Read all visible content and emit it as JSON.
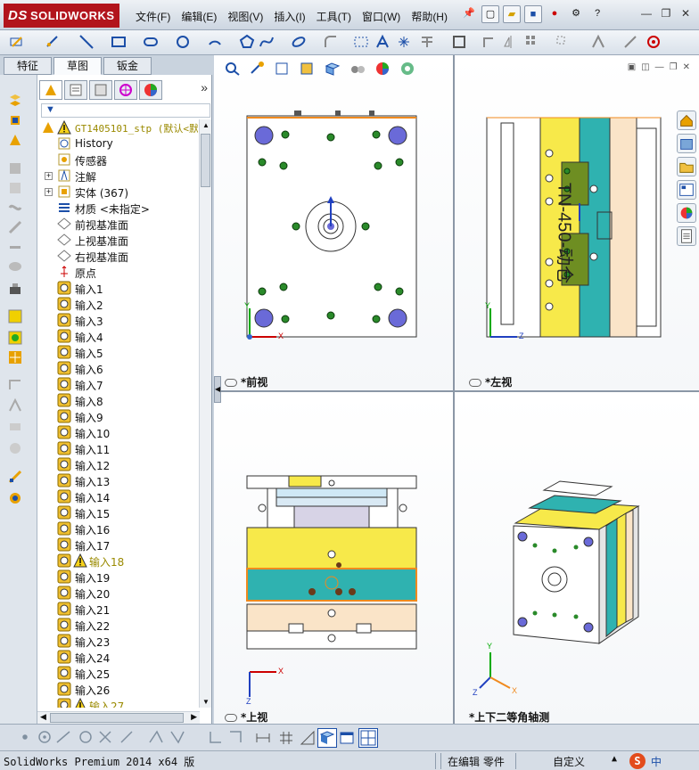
{
  "app": {
    "logo_text": "SOLIDWORKS",
    "logo_prefix": "DS"
  },
  "menu": [
    "文件(F)",
    "编辑(E)",
    "视图(V)",
    "插入(I)",
    "工具(T)",
    "窗口(W)",
    "帮助(H)"
  ],
  "quick_access": [
    "pin-icon",
    "new-icon",
    "open-icon",
    "save-icon",
    "rebuild-icon",
    "options-icon",
    "help-icon"
  ],
  "cm_tabs": [
    "特征",
    "草图",
    "钣金"
  ],
  "cm_active_tab": "草图",
  "tree": {
    "root": "GT1405101_stp  (默认<默",
    "items": [
      {
        "label": "History",
        "icon": "history-icon",
        "expand": false
      },
      {
        "label": "传感器",
        "icon": "sensor-icon",
        "expand": false
      },
      {
        "label": "注解",
        "icon": "annotation-icon",
        "expand": true
      },
      {
        "label": "实体 (367)",
        "icon": "solid-bodies-icon",
        "expand": true
      },
      {
        "label": "材质 <未指定>",
        "icon": "material-icon",
        "expand": false
      },
      {
        "label": "前视基准面",
        "icon": "plane-icon",
        "expand": false
      },
      {
        "label": "上视基准面",
        "icon": "plane-icon",
        "expand": false
      },
      {
        "label": "右视基准面",
        "icon": "plane-icon",
        "expand": false
      },
      {
        "label": "原点",
        "icon": "origin-icon",
        "expand": false
      },
      {
        "label": "输入1",
        "icon": "import-icon",
        "warn": false
      },
      {
        "label": "输入2",
        "icon": "import-icon",
        "warn": false
      },
      {
        "label": "输入3",
        "icon": "import-icon",
        "warn": false
      },
      {
        "label": "输入4",
        "icon": "import-icon",
        "warn": false
      },
      {
        "label": "输入5",
        "icon": "import-icon",
        "warn": false
      },
      {
        "label": "输入6",
        "icon": "import-icon",
        "warn": false
      },
      {
        "label": "输入7",
        "icon": "import-icon",
        "warn": false
      },
      {
        "label": "输入8",
        "icon": "import-icon",
        "warn": false
      },
      {
        "label": "输入9",
        "icon": "import-icon",
        "warn": false
      },
      {
        "label": "输入10",
        "icon": "import-icon",
        "warn": false
      },
      {
        "label": "输入11",
        "icon": "import-icon",
        "warn": false
      },
      {
        "label": "输入12",
        "icon": "import-icon",
        "warn": false
      },
      {
        "label": "输入13",
        "icon": "import-icon",
        "warn": false
      },
      {
        "label": "输入14",
        "icon": "import-icon",
        "warn": false
      },
      {
        "label": "输入15",
        "icon": "import-icon",
        "warn": false
      },
      {
        "label": "输入16",
        "icon": "import-icon",
        "warn": false
      },
      {
        "label": "输入17",
        "icon": "import-icon",
        "warn": false
      },
      {
        "label": "输入18",
        "icon": "import-icon",
        "warn": true
      },
      {
        "label": "输入19",
        "icon": "import-icon",
        "warn": false
      },
      {
        "label": "输入20",
        "icon": "import-icon",
        "warn": false
      },
      {
        "label": "输入21",
        "icon": "import-icon",
        "warn": false
      },
      {
        "label": "输入22",
        "icon": "import-icon",
        "warn": false
      },
      {
        "label": "输入23",
        "icon": "import-icon",
        "warn": false
      },
      {
        "label": "输入24",
        "icon": "import-icon",
        "warn": false
      },
      {
        "label": "输入25",
        "icon": "import-icon",
        "warn": false
      },
      {
        "label": "输入26",
        "icon": "import-icon",
        "warn": false
      },
      {
        "label": "输入27",
        "icon": "import-icon",
        "warn": true
      }
    ]
  },
  "views": {
    "front": "*前视",
    "left": "*左视",
    "top": "*上视",
    "iso": "*上下二等角轴测"
  },
  "part_text": "TN-450-动仓",
  "axes": {
    "x": "X",
    "y": "Y",
    "z": "Z"
  },
  "status": {
    "version": "SolidWorks Premium 2014 x64 版",
    "mode": "在编辑 零件",
    "units": "自定义",
    "ime": "中"
  },
  "colors": {
    "accent": "#b2141c",
    "plate_yellow": "#f7e94a",
    "plate_teal": "#2fb2b0",
    "plate_peach": "#fae4c8",
    "plate_olive": "#6e8e22",
    "highlight_orange": "#f08a1e",
    "warn_text": "#9a8a00"
  }
}
